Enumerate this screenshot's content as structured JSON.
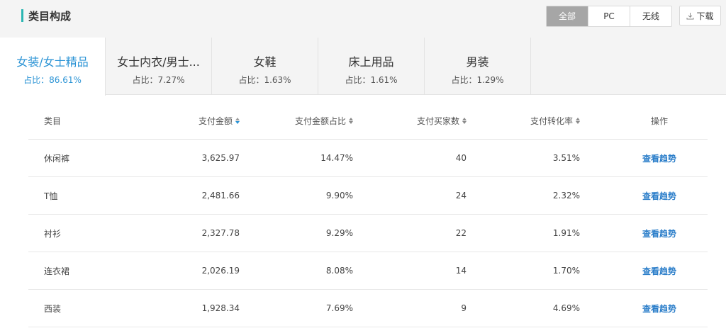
{
  "header": {
    "title": "类目构成",
    "segments": [
      "全部",
      "PC",
      "无线"
    ],
    "active_segment": "全部",
    "download_label": "下载"
  },
  "tabs": [
    {
      "name": "女装/女士精品",
      "share": "占比：86.61%",
      "active": true
    },
    {
      "name": "女士内衣/男士...",
      "share": "占比：7.27%"
    },
    {
      "name": "女鞋",
      "share": "占比：1.63%"
    },
    {
      "name": "床上用品",
      "share": "占比：1.61%"
    },
    {
      "name": "男装",
      "share": "占比：1.29%"
    }
  ],
  "table": {
    "columns": [
      "类目",
      "支付金额",
      "支付金额占比",
      "支付买家数",
      "支付转化率",
      "操作"
    ],
    "sorted_column": "支付金额",
    "rows": [
      {
        "category": "休闲裤",
        "amount": "3,625.97",
        "amount_share": "14.47%",
        "buyers": "40",
        "conversion": "3.51%",
        "action": "查看趋势"
      },
      {
        "category": "T恤",
        "amount": "2,481.66",
        "amount_share": "9.90%",
        "buyers": "24",
        "conversion": "2.32%",
        "action": "查看趋势"
      },
      {
        "category": "衬衫",
        "amount": "2,327.78",
        "amount_share": "9.29%",
        "buyers": "22",
        "conversion": "1.91%",
        "action": "查看趋势"
      },
      {
        "category": "连衣裙",
        "amount": "2,026.19",
        "amount_share": "8.08%",
        "buyers": "14",
        "conversion": "1.70%",
        "action": "查看趋势"
      },
      {
        "category": "西装",
        "amount": "1,928.34",
        "amount_share": "7.69%",
        "buyers": "9",
        "conversion": "4.69%",
        "action": "查看趋势"
      }
    ]
  },
  "colors": {
    "accent_bar": "#2cb6b3",
    "active_tab_text": "#2a93d5",
    "link": "#2a7dc9",
    "active_segment_bg": "#a6a6a6"
  }
}
